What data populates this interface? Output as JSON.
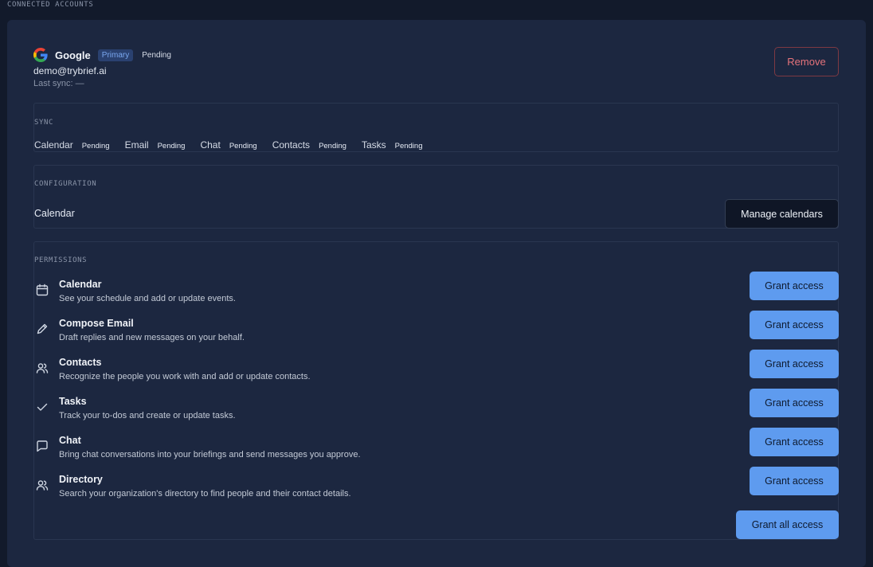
{
  "section_heading": "CONNECTED ACCOUNTS",
  "account": {
    "provider": "Google",
    "primary_badge": "Primary",
    "status": "Pending",
    "email": "demo@trybrief.ai",
    "last_sync": "Last sync: —",
    "remove_label": "Remove",
    "colors": {
      "remove": "#e5737b",
      "primary_badge_bg": "#2a4170"
    }
  },
  "sync": {
    "heading": "SYNC",
    "items": [
      {
        "name": "Calendar",
        "status": "Pending"
      },
      {
        "name": "Email",
        "status": "Pending"
      },
      {
        "name": "Chat",
        "status": "Pending"
      },
      {
        "name": "Contacts",
        "status": "Pending"
      },
      {
        "name": "Tasks",
        "status": "Pending"
      }
    ]
  },
  "configuration": {
    "heading": "CONFIGURATION",
    "label": "Calendar",
    "button_label": "Manage calendars"
  },
  "permissions": {
    "heading": "PERMISSIONS",
    "items": [
      {
        "icon": "calendar-icon",
        "title": "Calendar",
        "description": "See your schedule and add or update events.",
        "button": "Grant access"
      },
      {
        "icon": "pencil-icon",
        "title": "Compose Email",
        "description": "Draft replies and new messages on your behalf.",
        "button": "Grant access"
      },
      {
        "icon": "users-icon",
        "title": "Contacts",
        "description": "Recognize the people you work with and add or update contacts.",
        "button": "Grant access"
      },
      {
        "icon": "check-icon",
        "title": "Tasks",
        "description": "Track your to-dos and create or update tasks.",
        "button": "Grant access"
      },
      {
        "icon": "chat-bubble-icon",
        "title": "Chat",
        "description": "Bring chat conversations into your briefings and send messages you approve.",
        "button": "Grant access"
      },
      {
        "icon": "users-icon",
        "title": "Directory",
        "description": "Search your organization's directory to find people and their contact details.",
        "button": "Grant access"
      }
    ],
    "grant_all_label": "Grant all access",
    "accent": "#5e9bef"
  }
}
